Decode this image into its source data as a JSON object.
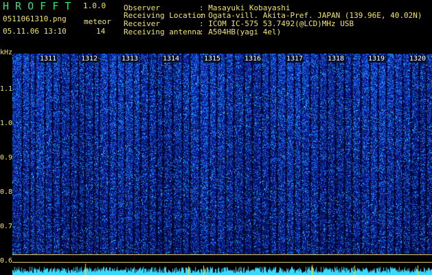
{
  "app": {
    "title": "H R O F F T",
    "version": "1.0.0",
    "filename": "0511061310.png",
    "datetime": "05.11.06 13:10",
    "meteor_label": "meteor",
    "meteor_count": "14"
  },
  "info": [
    {
      "key": "Observer",
      "value": ": Masayuki Kobayashi"
    },
    {
      "key": "Receiving Location",
      "value": ": Ogata-vill. Akita-Pref. JAPAN (139.96E, 40.02N)"
    },
    {
      "key": "Receiver",
      "value": ": ICOM IC-575 53.7492(@LCD)MHz USB"
    },
    {
      "key": "Receiving antenna",
      "value": ": A504HB(yagi 4el)"
    }
  ],
  "spectrogram": {
    "unit": "kHz",
    "y_ticks": [
      "1.1",
      "1.0",
      "0.9",
      "0.8",
      "0.7",
      "0.6"
    ],
    "time_labels": [
      "1311",
      "1312",
      "1313",
      "1314",
      "1315",
      "1316",
      "1317",
      "1318",
      "1319",
      "1320"
    ],
    "colors": {
      "background": "#000000",
      "low": "#0a1a7a",
      "mid": "#1f5cff",
      "high": "#36d9ff",
      "peak": "#ffe23a",
      "label": "#f4e46a",
      "title": "#39e36b"
    }
  }
}
